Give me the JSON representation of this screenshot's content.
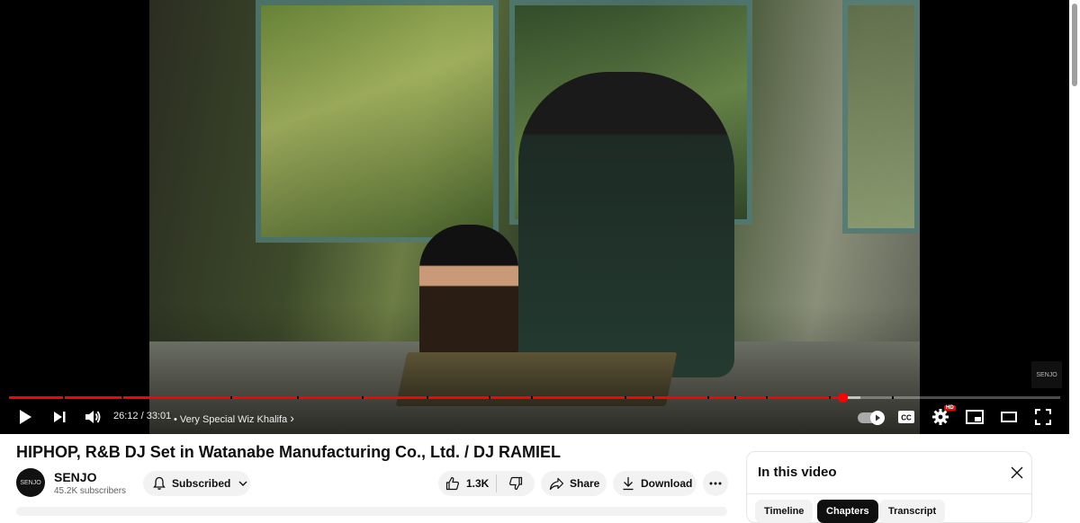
{
  "player": {
    "time_display": "26:12 / 33:01",
    "chapter_title": "• Very Special Wiz Khalifa",
    "chapter_arrow": "›",
    "watermark_text": "SENJO",
    "progress_fraction": 0.793,
    "buffered_fraction": 0.81,
    "chapter_markers": [
      0.051,
      0.107,
      0.211,
      0.274,
      0.336,
      0.397,
      0.456,
      0.497,
      0.586,
      0.612,
      0.664,
      0.69,
      0.72,
      0.78,
      0.84
    ],
    "controls": {
      "play_icon": "play-icon",
      "next_icon": "next-icon",
      "volume_icon": "volume-icon",
      "autoplay_icon": "autoplay-toggle",
      "captions_icon": "captions-icon",
      "settings_icon": "gear-icon",
      "hd_badge": "HD",
      "miniplayer_icon": "miniplayer-icon",
      "theater_icon": "theater-icon",
      "fullscreen_icon": "fullscreen-icon"
    },
    "accent_color": "#ff0000"
  },
  "video": {
    "title": "HIPHOP, R&B DJ Set in Watanabe Manufacturing Co., Ltd. / DJ RAMIEL"
  },
  "owner": {
    "avatar_text": "SENJO",
    "channel_name": "SENJO",
    "subscribers": "45.2K subscribers",
    "subscribe_label": "Subscribed"
  },
  "actions": {
    "like_count": "1.3K",
    "share_label": "Share",
    "download_label": "Download"
  },
  "panel": {
    "title": "In this video",
    "tabs": [
      {
        "label": "Timeline",
        "active": false
      },
      {
        "label": "Chapters",
        "active": true
      },
      {
        "label": "Transcript",
        "active": false
      }
    ]
  }
}
